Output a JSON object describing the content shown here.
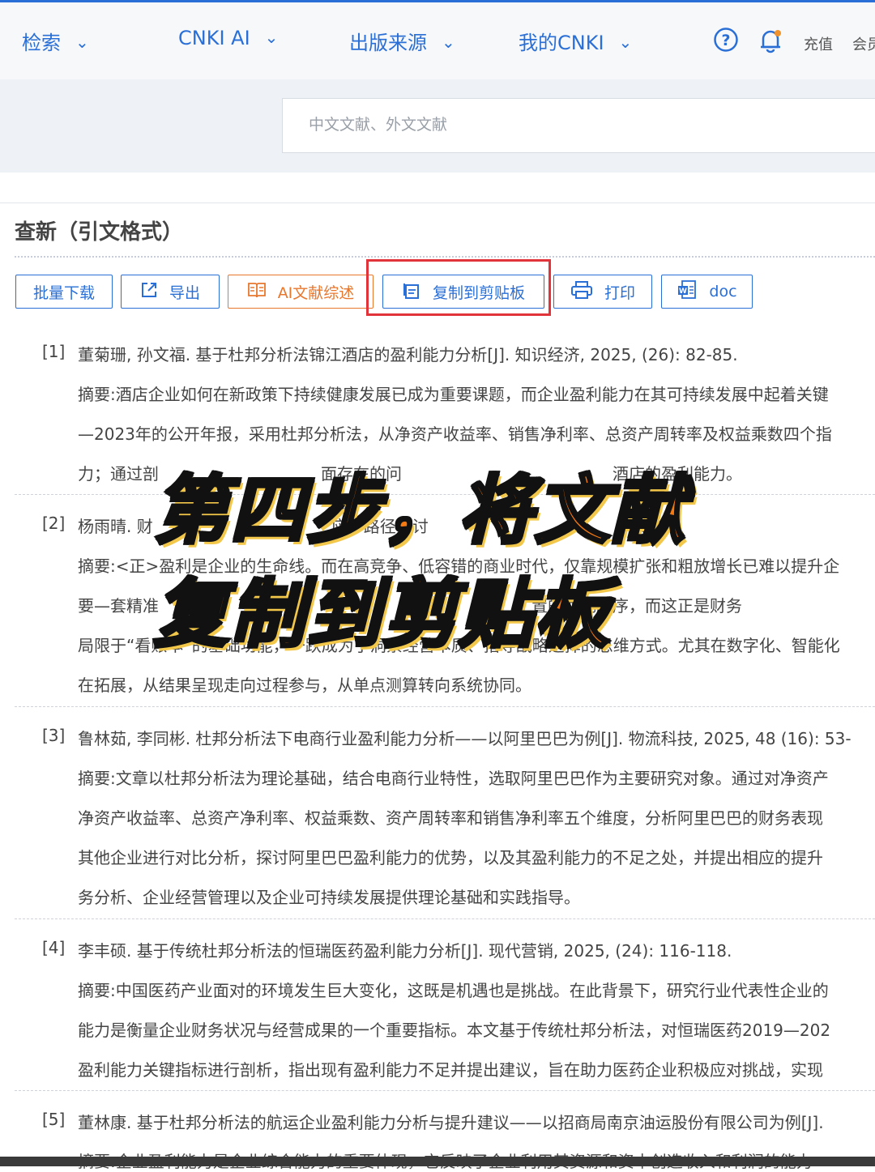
{
  "nav": {
    "items": [
      "检索",
      "CNKI AI",
      "出版来源",
      "我的CNKI"
    ],
    "recharge": "充值",
    "member": "会员"
  },
  "search": {
    "placeholder": "中文文献、外文文献"
  },
  "section": {
    "title": "查新（引文格式）"
  },
  "toolbar": {
    "batch_download": "批量下载",
    "export": "导出",
    "ai_review": "AI文献综述",
    "copy_clipboard": "复制到剪贴板",
    "print": "打印",
    "doc": "doc"
  },
  "references": [
    {
      "num": "[1]",
      "citation": "董菊珊, 孙文福. 基于杜邦分析法锦江酒店的盈利能力分析[J]. 知识经济, 2025, (26): 82-85.",
      "abstract": [
        "摘要:酒店企业如何在新政策下持续健康发展已成为重要课题，而企业盈利能力在其可持续发展中起着关键",
        "—2023年的公开年报，采用杜邦分析法，从净资产收益率、销售净利率、总资产周转率及权益乘数四个指",
        "力；通过剖　　　　　　　　　　面存在的问　　　　　　　　　　　　　酒店的盈利能力。"
      ]
    },
    {
      "num": "[2]",
      "citation": "杨雨晴. 财　　　　　　　　　　　应　路径探讨　　　　　　　　　　　　　65.",
      "abstract": [
        "摘要:<正>盈利是企业的生命线。而在高竞争、低容错的商业时代，仅靠规模扩张和粗放增长已难以提升企",
        "要—套精准　　　　　　　　　　　　　　　　　　　　　　　置的优先顺序，而这正是财务",
        "局限于“看账本”的基础功能，一跃成为了洞察经营本质、指导战略选择的思维方式。尤其在数字化、智能化",
        "在拓展，从结果呈现走向过程参与，从单点测算转向系统协同。"
      ]
    },
    {
      "num": "[3]",
      "citation": "鲁林茹, 李同彬. 杜邦分析法下电商行业盈利能力分析——以阿里巴巴为例[J]. 物流科技, 2025, 48 (16): 53-",
      "abstract": [
        "摘要:文章以杜邦分析法为理论基础，结合电商行业特性，选取阿里巴巴作为主要研究对象。通过对净资产",
        "净资产收益率、总资产净利率、权益乘数、资产周转率和销售净利率五个维度，分析阿里巴巴的财务表现",
        "其他企业进行对比分析，探讨阿里巴巴盈利能力的优势，以及其盈利能力的不足之处，并提出相应的提升",
        "务分析、企业经营管理以及企业可持续发展提供理论基础和实践指导。"
      ]
    },
    {
      "num": "[4]",
      "citation": "李丰硕. 基于传统杜邦分析法的恒瑞医药盈利能力分析[J]. 现代营销, 2025, (24): 116-118.",
      "abstract": [
        "摘要:中国医药产业面对的环境发生巨大变化，这既是机遇也是挑战。在此背景下，研究行业代表性企业的",
        "能力是衡量企业财务状况与经营成果的一个重要指标。本文基于传统杜邦分析法，对恒瑞医药2019—202",
        "盈利能力关键指标进行剖析，指出现有盈利能力不足并提出建议，旨在助力医药企业积极应对挑战，实现"
      ]
    },
    {
      "num": "[5]",
      "citation": "董林康. 基于杜邦分析法的航运企业盈利能力分析与提升建议——以招商局南京油运股份有限公司为例[J].",
      "abstract": [
        "摘要:企业盈利能力是企业综合能力的重要体现，它反映了企业利用其资源和资本创造收入和利润的能力"
      ]
    }
  ],
  "overlay": {
    "line1": "第四步，将文献",
    "line2": "复制到剪贴板"
  },
  "colors": {
    "accent": "#2a6fd6",
    "ai_button": "#e8772e",
    "highlight": "#e0333a",
    "overlay_fill": "#f57a12"
  }
}
